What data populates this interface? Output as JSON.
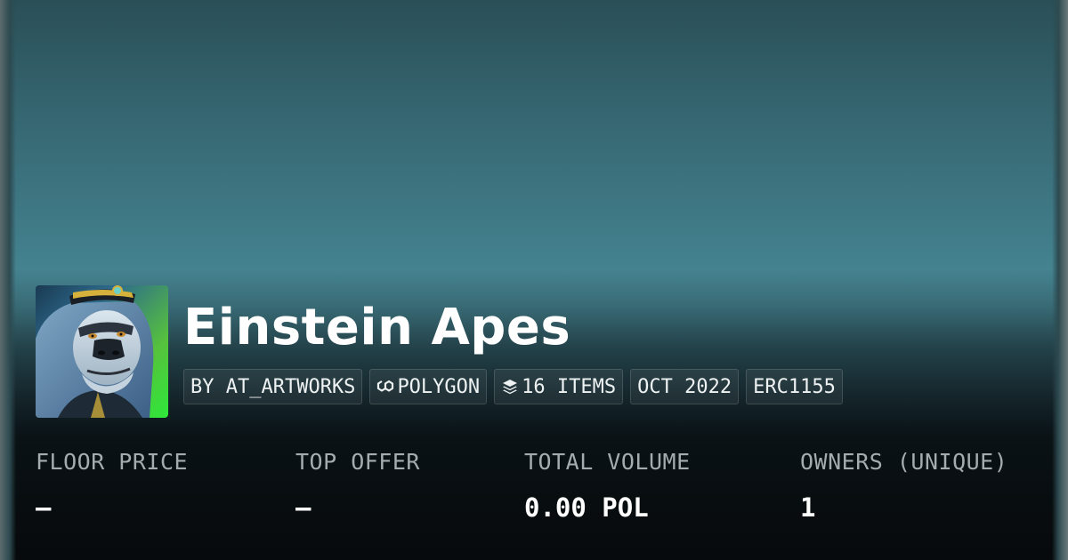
{
  "collection": {
    "name": "Einstein Apes",
    "avatar_icon": "ape-avatar-image"
  },
  "chips": [
    {
      "label": "BY AT_ARTWORKS",
      "icon": ""
    },
    {
      "label": "POLYGON",
      "icon": "polygon-icon"
    },
    {
      "label": "16 ITEMS",
      "icon": "layers-icon"
    },
    {
      "label": "OCT 2022",
      "icon": ""
    },
    {
      "label": "ERC1155",
      "icon": ""
    }
  ],
  "stats": [
    {
      "label": "FLOOR PRICE",
      "value": "–"
    },
    {
      "label": "TOP OFFER",
      "value": "–"
    },
    {
      "label": "TOTAL VOLUME",
      "value": "0.00 POL"
    },
    {
      "label": "OWNERS (UNIQUE)",
      "value": "1"
    }
  ],
  "colors": {
    "banner_top": "#2a4f57",
    "banner_mid": "#4a8c99",
    "footer_bg": "#070a0c",
    "label_gray": "#a4acb0",
    "text_white": "#ffffff"
  }
}
